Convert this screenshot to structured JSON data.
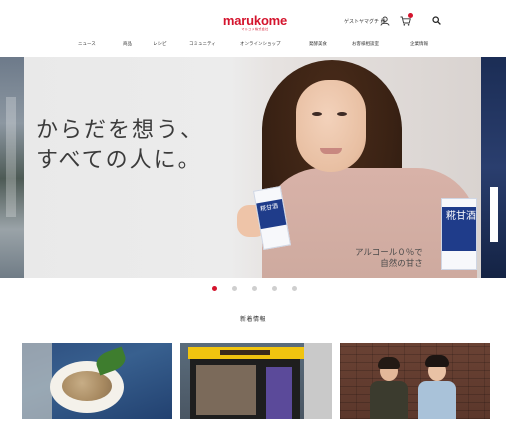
{
  "header": {
    "logo": "marukome",
    "logo_tagline": "マルコメ株式会社",
    "greeting": "ゲストヤマグチ 様",
    "icons": [
      "user-icon",
      "cart-icon",
      "search-icon"
    ]
  },
  "nav": {
    "items": [
      "ニュース",
      "商品",
      "レシピ",
      "コミュニティ",
      "オンラインショップ",
      "発酵美食",
      "お客様相談室",
      "企業情報"
    ]
  },
  "hero": {
    "headline_line1": "からだを想う、",
    "headline_line2": "すべての人に。",
    "pack_small_text": "糀甘酒",
    "pack_large_text": "糀甘酒",
    "caption_line1": "アルコール０％で",
    "caption_line2": "自然の甘さ",
    "slide_count": 5,
    "active_slide": 1
  },
  "section": {
    "title": "新着情報"
  },
  "colors": {
    "brand_red": "#d4142d",
    "text": "#333333",
    "dot_inactive": "#cfcfcf"
  }
}
